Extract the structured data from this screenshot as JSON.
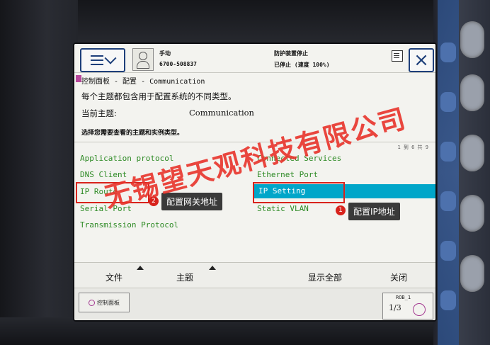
{
  "header": {
    "mode": "手动",
    "serial": "6700-508837",
    "guard_status": "防护装置停止",
    "speed_status": "已停止 (速度 100%)"
  },
  "breadcrumb": "控制面板 - 配置 - Communication",
  "description": "每个主题都包含用于配置系统的不同类型。",
  "topic": {
    "label": "当前主题:",
    "value": "Communication"
  },
  "instruction": "选择您需要查看的主题和实例类型。",
  "list_page": "1 到 6 共 9",
  "items_left": [
    "Application protocol",
    "DNS Client",
    "IP Route",
    "Serial Port",
    "Transmission Protocol"
  ],
  "items_right": [
    "Connected Services",
    "Ethernet Port",
    "IP Setting",
    "Static VLAN"
  ],
  "selected_item": "IP Setting",
  "toolbar": {
    "file": "文件",
    "topic": "主题",
    "show_all": "显示全部",
    "close": "关闭"
  },
  "status_bar": {
    "control_panel": "控制面板",
    "robot": "ROB_1",
    "fraction": "1/3"
  },
  "annotations": {
    "gateway_num": "2",
    "gateway_label": "配置网关地址",
    "ip_num": "1",
    "ip_label": "配置IP地址",
    "watermark": "无锡望天观科技有限公司"
  },
  "colors": {
    "accent": "#1e3f7a",
    "selection": "#00a6c9",
    "item_text": "#2d8a24",
    "marker": "#d8231c"
  }
}
